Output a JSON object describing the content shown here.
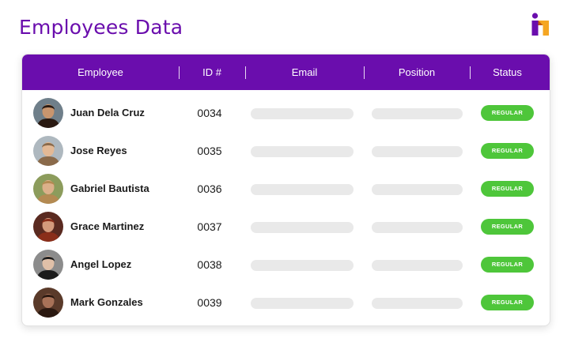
{
  "page": {
    "title": "Employees Data"
  },
  "colors": {
    "accent": "#6a0dad",
    "title": "#6a0dad",
    "header_bg": "#6a0dad",
    "badge_bg": "#4ec63a",
    "logo_purple": "#6a0dad",
    "logo_orange": "#f5a623"
  },
  "logo": {
    "icon": "brand-logo-icon"
  },
  "table": {
    "columns": [
      "Employee",
      "ID #",
      "Email",
      "Position",
      "Status"
    ],
    "rows": [
      {
        "name": "Juan Dela Cruz",
        "id": "0034",
        "status": "REGULAR",
        "avatar": {
          "skin": "#c8956e",
          "hair": "#2a1a12",
          "bg": "#6f7f8a"
        }
      },
      {
        "name": "Jose Reyes",
        "id": "0035",
        "status": "REGULAR",
        "avatar": {
          "skin": "#e3b995",
          "hair": "#8a6a4a",
          "bg": "#aeb8bf"
        }
      },
      {
        "name": "Gabriel Bautista",
        "id": "0036",
        "status": "REGULAR",
        "avatar": {
          "skin": "#dcb08a",
          "hair": "#b48a52",
          "bg": "#8c9c5c"
        }
      },
      {
        "name": "Grace Martinez",
        "id": "0037",
        "status": "REGULAR",
        "avatar": {
          "skin": "#d49a7c",
          "hair": "#8a2e1a",
          "bg": "#5a2a20"
        }
      },
      {
        "name": "Angel Lopez",
        "id": "0038",
        "status": "REGULAR",
        "avatar": {
          "skin": "#e0c0a8",
          "hair": "#1c1c1c",
          "bg": "#8c8c8c"
        }
      },
      {
        "name": "Mark Gonzales",
        "id": "0039",
        "status": "REGULAR",
        "avatar": {
          "skin": "#a87258",
          "hair": "#2a1810",
          "bg": "#5a3a2a"
        }
      }
    ]
  }
}
